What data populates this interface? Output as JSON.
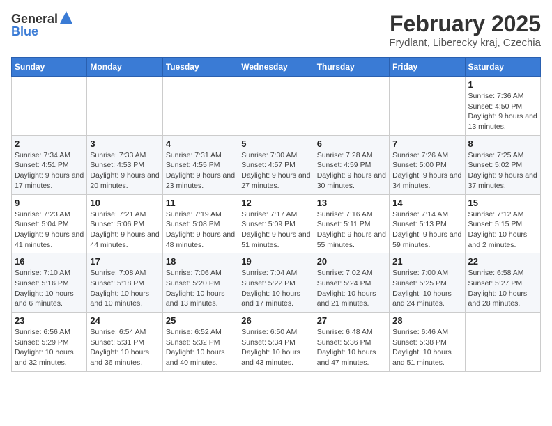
{
  "logo": {
    "general": "General",
    "blue": "Blue"
  },
  "title": "February 2025",
  "subtitle": "Frydlant, Liberecky kraj, Czechia",
  "headers": [
    "Sunday",
    "Monday",
    "Tuesday",
    "Wednesday",
    "Thursday",
    "Friday",
    "Saturday"
  ],
  "weeks": [
    [
      {
        "day": "",
        "info": ""
      },
      {
        "day": "",
        "info": ""
      },
      {
        "day": "",
        "info": ""
      },
      {
        "day": "",
        "info": ""
      },
      {
        "day": "",
        "info": ""
      },
      {
        "day": "",
        "info": ""
      },
      {
        "day": "1",
        "info": "Sunrise: 7:36 AM\nSunset: 4:50 PM\nDaylight: 9 hours and 13 minutes."
      }
    ],
    [
      {
        "day": "2",
        "info": "Sunrise: 7:34 AM\nSunset: 4:51 PM\nDaylight: 9 hours and 17 minutes."
      },
      {
        "day": "3",
        "info": "Sunrise: 7:33 AM\nSunset: 4:53 PM\nDaylight: 9 hours and 20 minutes."
      },
      {
        "day": "4",
        "info": "Sunrise: 7:31 AM\nSunset: 4:55 PM\nDaylight: 9 hours and 23 minutes."
      },
      {
        "day": "5",
        "info": "Sunrise: 7:30 AM\nSunset: 4:57 PM\nDaylight: 9 hours and 27 minutes."
      },
      {
        "day": "6",
        "info": "Sunrise: 7:28 AM\nSunset: 4:59 PM\nDaylight: 9 hours and 30 minutes."
      },
      {
        "day": "7",
        "info": "Sunrise: 7:26 AM\nSunset: 5:00 PM\nDaylight: 9 hours and 34 minutes."
      },
      {
        "day": "8",
        "info": "Sunrise: 7:25 AM\nSunset: 5:02 PM\nDaylight: 9 hours and 37 minutes."
      }
    ],
    [
      {
        "day": "9",
        "info": "Sunrise: 7:23 AM\nSunset: 5:04 PM\nDaylight: 9 hours and 41 minutes."
      },
      {
        "day": "10",
        "info": "Sunrise: 7:21 AM\nSunset: 5:06 PM\nDaylight: 9 hours and 44 minutes."
      },
      {
        "day": "11",
        "info": "Sunrise: 7:19 AM\nSunset: 5:08 PM\nDaylight: 9 hours and 48 minutes."
      },
      {
        "day": "12",
        "info": "Sunrise: 7:17 AM\nSunset: 5:09 PM\nDaylight: 9 hours and 51 minutes."
      },
      {
        "day": "13",
        "info": "Sunrise: 7:16 AM\nSunset: 5:11 PM\nDaylight: 9 hours and 55 minutes."
      },
      {
        "day": "14",
        "info": "Sunrise: 7:14 AM\nSunset: 5:13 PM\nDaylight: 9 hours and 59 minutes."
      },
      {
        "day": "15",
        "info": "Sunrise: 7:12 AM\nSunset: 5:15 PM\nDaylight: 10 hours and 2 minutes."
      }
    ],
    [
      {
        "day": "16",
        "info": "Sunrise: 7:10 AM\nSunset: 5:16 PM\nDaylight: 10 hours and 6 minutes."
      },
      {
        "day": "17",
        "info": "Sunrise: 7:08 AM\nSunset: 5:18 PM\nDaylight: 10 hours and 10 minutes."
      },
      {
        "day": "18",
        "info": "Sunrise: 7:06 AM\nSunset: 5:20 PM\nDaylight: 10 hours and 13 minutes."
      },
      {
        "day": "19",
        "info": "Sunrise: 7:04 AM\nSunset: 5:22 PM\nDaylight: 10 hours and 17 minutes."
      },
      {
        "day": "20",
        "info": "Sunrise: 7:02 AM\nSunset: 5:24 PM\nDaylight: 10 hours and 21 minutes."
      },
      {
        "day": "21",
        "info": "Sunrise: 7:00 AM\nSunset: 5:25 PM\nDaylight: 10 hours and 24 minutes."
      },
      {
        "day": "22",
        "info": "Sunrise: 6:58 AM\nSunset: 5:27 PM\nDaylight: 10 hours and 28 minutes."
      }
    ],
    [
      {
        "day": "23",
        "info": "Sunrise: 6:56 AM\nSunset: 5:29 PM\nDaylight: 10 hours and 32 minutes."
      },
      {
        "day": "24",
        "info": "Sunrise: 6:54 AM\nSunset: 5:31 PM\nDaylight: 10 hours and 36 minutes."
      },
      {
        "day": "25",
        "info": "Sunrise: 6:52 AM\nSunset: 5:32 PM\nDaylight: 10 hours and 40 minutes."
      },
      {
        "day": "26",
        "info": "Sunrise: 6:50 AM\nSunset: 5:34 PM\nDaylight: 10 hours and 43 minutes."
      },
      {
        "day": "27",
        "info": "Sunrise: 6:48 AM\nSunset: 5:36 PM\nDaylight: 10 hours and 47 minutes."
      },
      {
        "day": "28",
        "info": "Sunrise: 6:46 AM\nSunset: 5:38 PM\nDaylight: 10 hours and 51 minutes."
      },
      {
        "day": "",
        "info": ""
      }
    ]
  ]
}
